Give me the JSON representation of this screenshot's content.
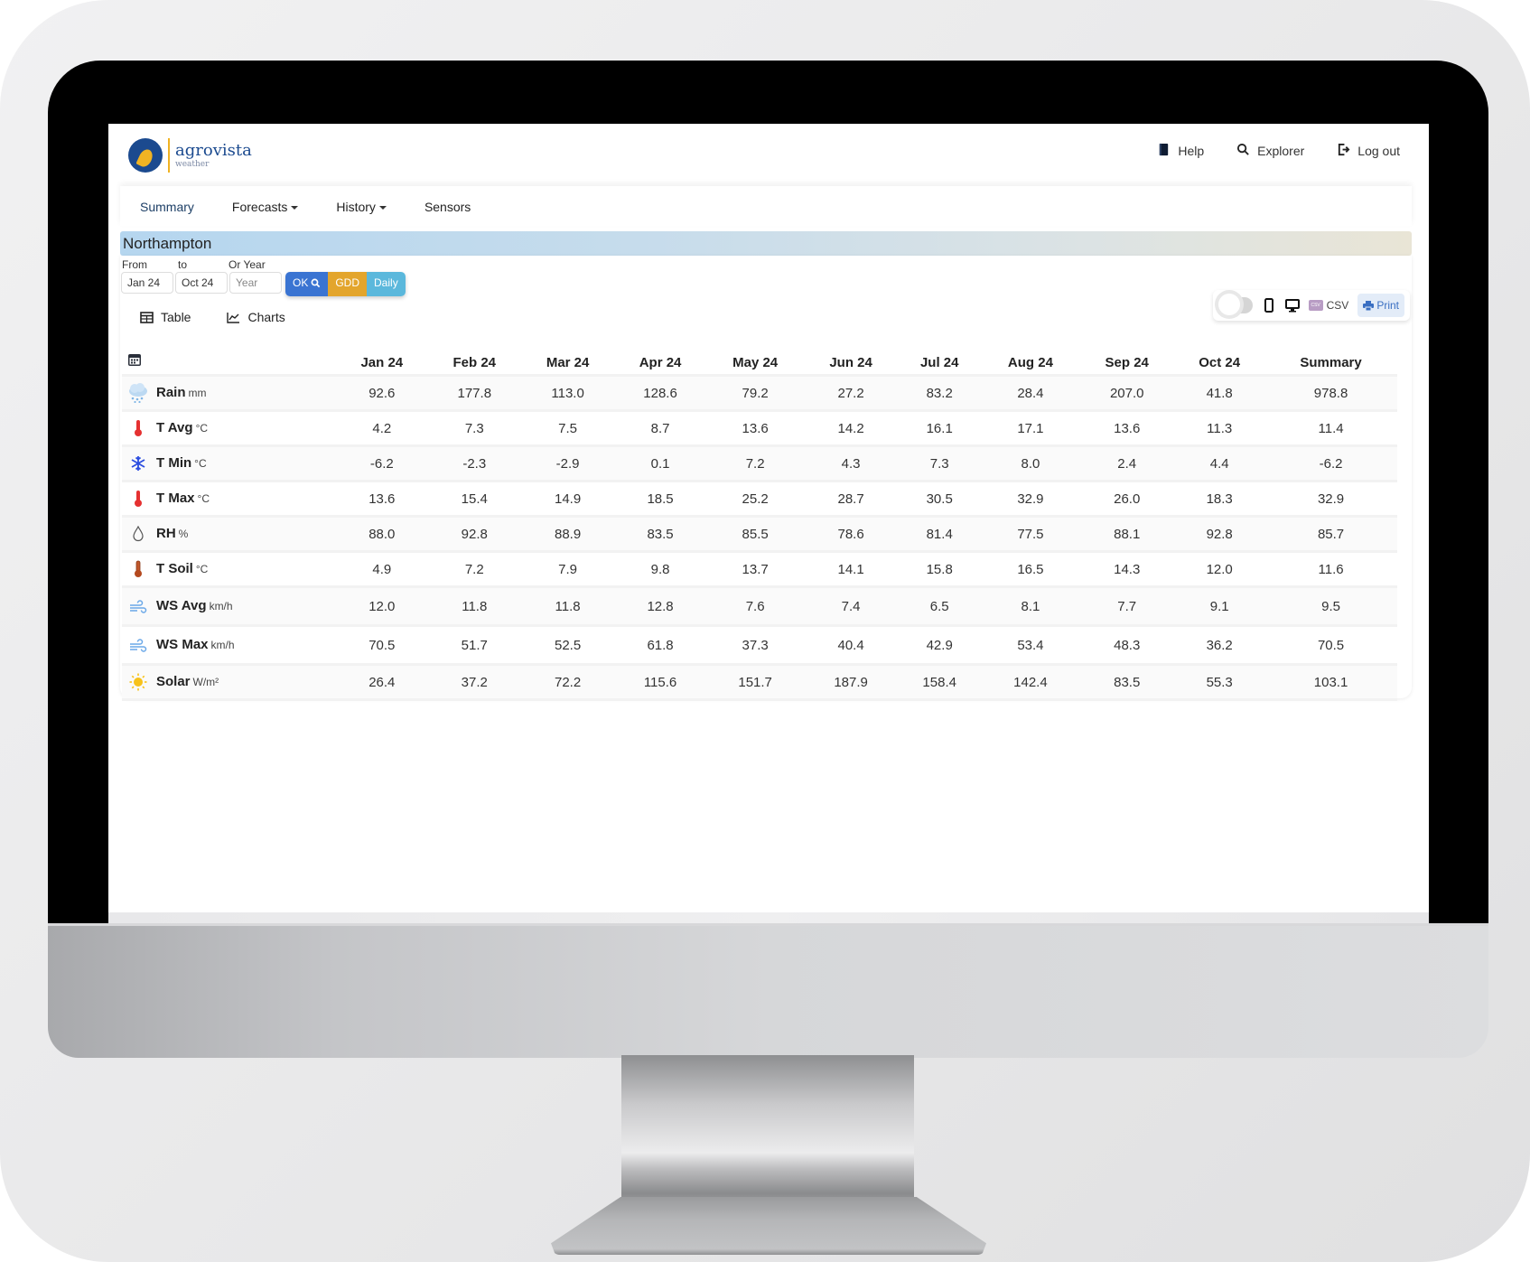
{
  "brand": {
    "name": "agrovista",
    "sub": "weather"
  },
  "top_links": [
    {
      "label": "Help",
      "icon": "book-icon"
    },
    {
      "label": "Explorer",
      "icon": "search-icon"
    },
    {
      "label": "Log out",
      "icon": "logout-icon"
    }
  ],
  "nav": [
    {
      "label": "Summary",
      "dropdown": false,
      "active": true
    },
    {
      "label": "Forecasts",
      "dropdown": true
    },
    {
      "label": "History",
      "dropdown": true
    },
    {
      "label": "Sensors",
      "dropdown": false
    }
  ],
  "location": "Northampton",
  "filters": {
    "from_label": "From",
    "to_label": "to",
    "year_label": "Or Year",
    "from_value": "Jan 24",
    "to_value": "Oct 24",
    "year_placeholder": "Year",
    "ok_label": "OK",
    "gdd_label": "GDD",
    "daily_label": "Daily"
  },
  "view_tabs": [
    {
      "label": "Table",
      "icon": "table-icon"
    },
    {
      "label": "Charts",
      "icon": "line-chart-icon"
    }
  ],
  "tools": {
    "csv_label": "CSV",
    "print_label": "Print"
  },
  "table": {
    "columns": [
      "Jan 24",
      "Feb 24",
      "Mar 24",
      "Apr 24",
      "May 24",
      "Jun 24",
      "Jul 24",
      "Aug 24",
      "Sep 24",
      "Oct 24",
      "Summary"
    ],
    "rows": [
      {
        "label": "Rain",
        "unit": "mm",
        "icon": "rain-cloud-icon",
        "values": [
          "92.6",
          "177.8",
          "113.0",
          "128.6",
          "79.2",
          "27.2",
          "83.2",
          "28.4",
          "207.0",
          "41.8",
          "978.8"
        ]
      },
      {
        "label": "T Avg",
        "unit": "°C",
        "icon": "thermometer-icon",
        "values": [
          "4.2",
          "7.3",
          "7.5",
          "8.7",
          "13.6",
          "14.2",
          "16.1",
          "17.1",
          "13.6",
          "11.3",
          "11.4"
        ]
      },
      {
        "label": "T Min",
        "unit": "°C",
        "icon": "snowflake-icon",
        "values": [
          "-6.2",
          "-2.3",
          "-2.9",
          "0.1",
          "7.2",
          "4.3",
          "7.3",
          "8.0",
          "2.4",
          "4.4",
          "-6.2"
        ]
      },
      {
        "label": "T Max",
        "unit": "°C",
        "icon": "thermometer-icon",
        "values": [
          "13.6",
          "15.4",
          "14.9",
          "18.5",
          "25.2",
          "28.7",
          "30.5",
          "32.9",
          "26.0",
          "18.3",
          "32.9"
        ]
      },
      {
        "label": "RH",
        "unit": "%",
        "icon": "droplet-icon",
        "values": [
          "88.0",
          "92.8",
          "88.9",
          "83.5",
          "85.5",
          "78.6",
          "81.4",
          "77.5",
          "88.1",
          "92.8",
          "85.7"
        ]
      },
      {
        "label": "T Soil",
        "unit": "°C",
        "icon": "soil-thermometer-icon",
        "values": [
          "4.9",
          "7.2",
          "7.9",
          "9.8",
          "13.7",
          "14.1",
          "15.8",
          "16.5",
          "14.3",
          "12.0",
          "11.6"
        ]
      },
      {
        "label": "WS Avg",
        "unit": "km/h",
        "icon": "wind-icon",
        "values": [
          "12.0",
          "11.8",
          "11.8",
          "12.8",
          "7.6",
          "7.4",
          "6.5",
          "8.1",
          "7.7",
          "9.1",
          "9.5"
        ]
      },
      {
        "label": "WS Max",
        "unit": "km/h",
        "icon": "wind-icon",
        "values": [
          "70.5",
          "51.7",
          "52.5",
          "61.8",
          "37.3",
          "40.4",
          "42.9",
          "53.4",
          "48.3",
          "36.2",
          "70.5"
        ]
      },
      {
        "label": "Solar",
        "unit": "W/m²",
        "icon": "sun-icon",
        "values": [
          "26.4",
          "37.2",
          "72.2",
          "115.6",
          "151.7",
          "187.9",
          "158.4",
          "142.4",
          "83.5",
          "55.3",
          "103.1"
        ]
      }
    ]
  },
  "colors": {
    "brand_blue": "#1b4a8f",
    "brand_yellow": "#f0b323",
    "ok_button": "#3a74d2",
    "gdd_button": "#e3a52c",
    "daily_button": "#5bb8dc"
  }
}
